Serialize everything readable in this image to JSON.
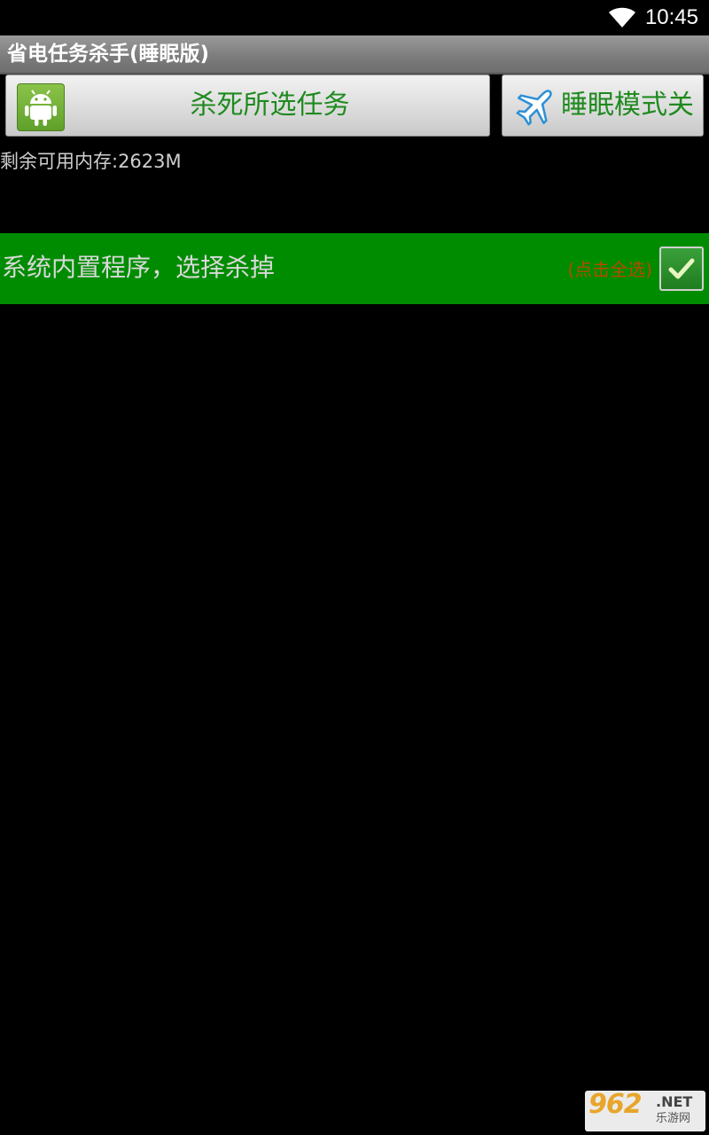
{
  "status_bar": {
    "time": "10:45",
    "wifi_icon": "wifi-icon"
  },
  "title_bar": {
    "title": "省电任务杀手(睡眠版)"
  },
  "toolbar": {
    "kill_button_label": "杀死所选任务",
    "kill_button_icon": "android-icon",
    "sleep_button_label": "睡眠模式关",
    "sleep_button_icon": "airplane-icon"
  },
  "memory": {
    "text": "剩余可用内存:2623M"
  },
  "task_group": {
    "label": "系统内置程序，选择杀掉",
    "select_all_hint": "(点击全选)",
    "checked": true
  },
  "watermark": {
    "main": "962",
    "suffix": ".NET",
    "sub": "乐游网"
  },
  "colors": {
    "group_row": "#008c00",
    "button_text": "#1f8a1f",
    "select_all_hint": "#b54a00",
    "background": "#000000"
  }
}
